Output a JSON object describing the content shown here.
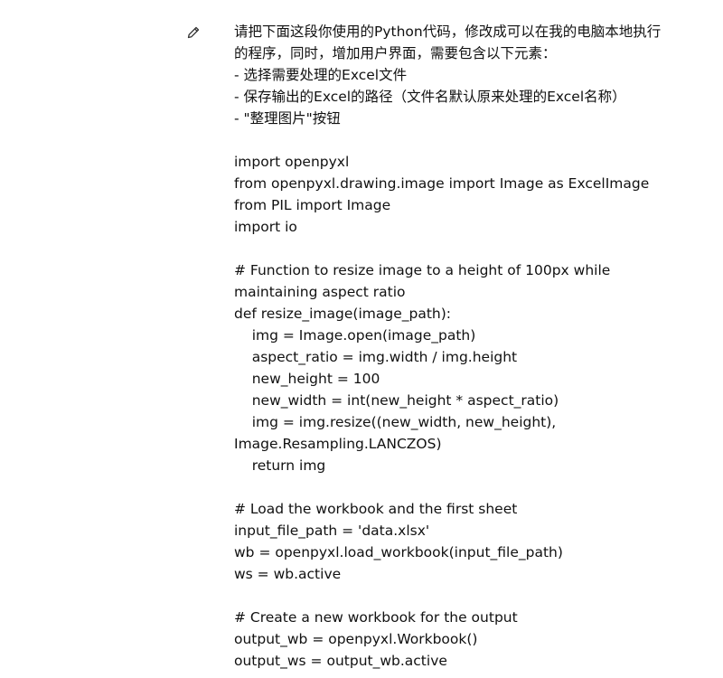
{
  "message": {
    "edit_icon": "pencil-icon",
    "lines": [
      "请把下面这段你使用的Python代码，修改成可以在我的电脑本地执行",
      "的程序，同时，增加用户界面，需要包含以下元素：",
      "- 选择需要处理的Excel文件",
      "- 保存输出的Excel的路径（文件名默认原来处理的Excel名称）",
      "- \"整理图片\"按钮",
      "",
      "import openpyxl",
      "from openpyxl.drawing.image import Image as ExcelImage",
      "from PIL import Image",
      "import io",
      "",
      "# Function to resize image to a height of 100px while",
      "maintaining aspect ratio",
      "def resize_image(image_path):",
      "    img = Image.open(image_path)",
      "    aspect_ratio = img.width / img.height",
      "    new_height = 100",
      "    new_width = int(new_height * aspect_ratio)",
      "    img = img.resize((new_width, new_height),",
      "Image.Resampling.LANCZOS)",
      "    return img",
      "",
      "# Load the workbook and the first sheet",
      "input_file_path = 'data.xlsx'",
      "wb = openpyxl.load_workbook(input_file_path)",
      "ws = wb.active",
      "",
      "# Create a new workbook for the output",
      "output_wb = openpyxl.Workbook()",
      "output_ws = output_wb.active"
    ]
  }
}
